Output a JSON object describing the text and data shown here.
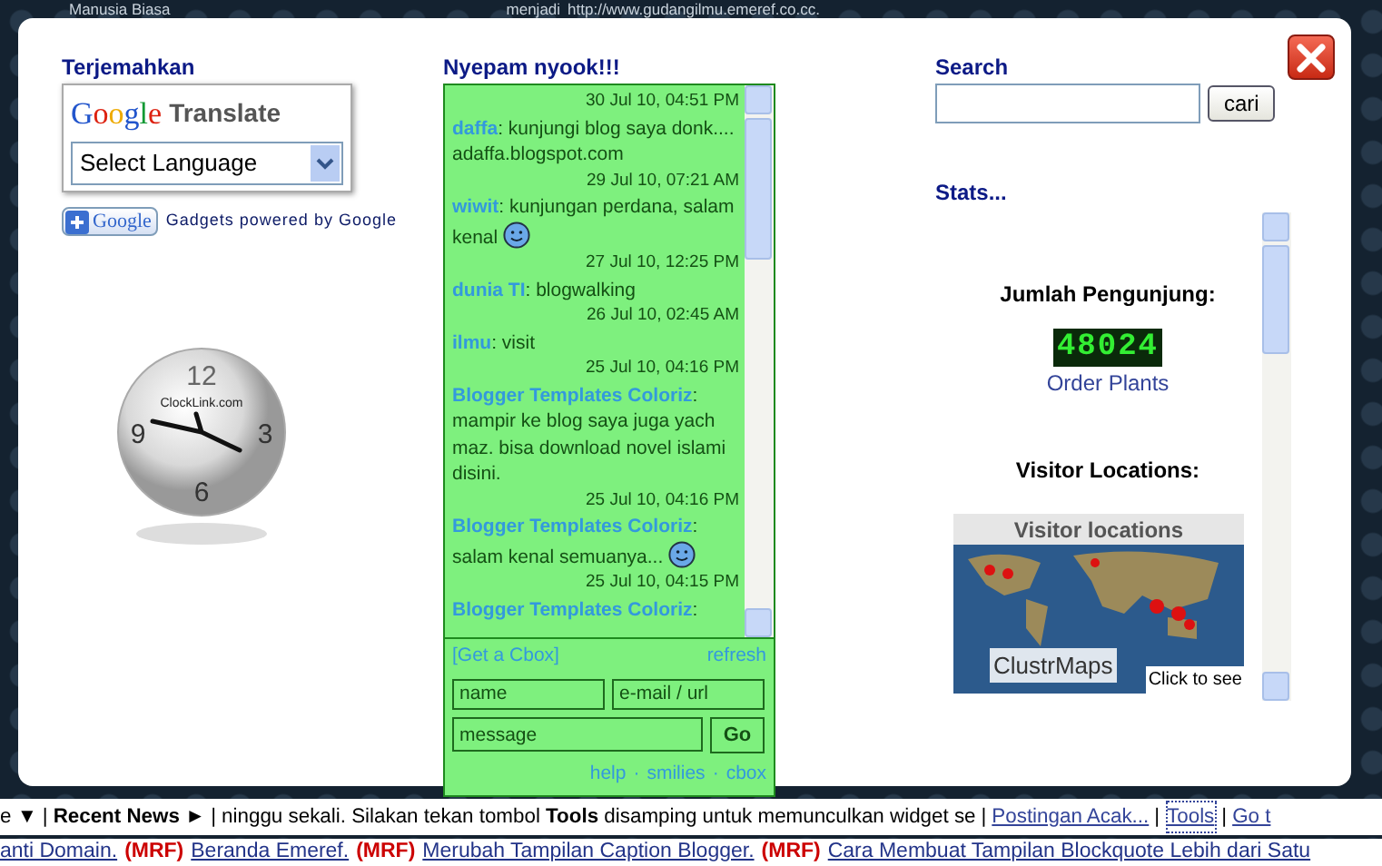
{
  "background": {
    "top_left_text": "Manusia Biasa",
    "top_text": "menjadi",
    "top_link": "http://www.gudangilmu.emeref.co.cc",
    "top_end": "."
  },
  "translate": {
    "heading": "Terjemahkan",
    "logo_word": "Google",
    "product": "Translate",
    "select": "Select Language",
    "gadget_button": "Google",
    "powered": "Gadgets powered by Google"
  },
  "clock": {
    "numbers": [
      "12",
      "3",
      "6",
      "9"
    ],
    "brand": "ClockLink.com"
  },
  "chat": {
    "heading": "Nyepam nyook!!!",
    "messages": [
      {
        "time": "30 Jul 10, 04:51 PM",
        "message": "**daffa**: kunjungi blog saya donk.... adaffa.blogspot.com",
        "smiley": false
      },
      {
        "time": "29 Jul 10, 07:21 AM",
        "message": "**wiwit**: kunjungan perdana, salam kenal",
        "smiley": true
      },
      {
        "time": "27 Jul 10, 12:25 PM",
        "message": "**dunia TI**: blogwalking",
        "smiley": false
      },
      {
        "time": "26 Jul 10, 02:45 AM",
        "message": "**ilmu**: visit",
        "smiley": false
      },
      {
        "time": "25 Jul 10, 04:16 PM",
        "message": "**Blogger Templates Coloriz**: mampir ke blog saya juga yach maz. bisa download novel islami disini.",
        "smiley": false
      },
      {
        "time": "25 Jul 10, 04:16 PM",
        "message": "**Blogger Templates Coloriz**: salam kenal semuanya...",
        "smiley": true
      },
      {
        "time": "25 Jul 10, 04:15 PM",
        "message": "**Blogger Templates Coloriz**:",
        "smiley": false
      }
    ],
    "get_link": "[Get a Cbox]",
    "refresh": "refresh",
    "name_placeholder": "name",
    "email_placeholder": "e-mail / url",
    "message_placeholder": "message",
    "go": "Go",
    "footer_links": [
      "help",
      "smilies",
      "cbox"
    ],
    "footer_separator": "·"
  },
  "search": {
    "heading": "Search",
    "button": "cari"
  },
  "stats": {
    "heading": "Stats...",
    "visitors_label": "Jumlah Pengunjung:",
    "counter": "48024",
    "counter_link": "Order Plants",
    "locations_label": "Visitor Locations:",
    "map_title": "Visitor locations",
    "map_brand": "ClustrMaps",
    "map_hint": "Click to see"
  },
  "ticker": [
    {
      "kind": "plain",
      "text": "e ▼"
    },
    {
      "kind": "sep",
      "text": "|"
    },
    {
      "kind": "bold",
      "text": "Recent News ►"
    },
    {
      "kind": "sep",
      "text": "|"
    },
    {
      "kind": "rich",
      "text": "ninggu sekali. Silakan tekan tombol **Tools** disamping untuk memunculkan widget se"
    },
    {
      "kind": "sep",
      "text": "|"
    },
    {
      "kind": "link",
      "text": "Postingan Acak..."
    },
    {
      "kind": "sep",
      "text": "|"
    },
    {
      "kind": "boxed",
      "text": "Tools"
    },
    {
      "kind": "sep",
      "text": "|"
    },
    {
      "kind": "link",
      "text": "Go t"
    }
  ],
  "news_line": [
    {
      "kind": "link",
      "text": "anti Domain."
    },
    {
      "kind": "tag",
      "text": "(MRF)"
    },
    {
      "kind": "link",
      "text": "Beranda Emeref."
    },
    {
      "kind": "tag",
      "text": "(MRF)"
    },
    {
      "kind": "link",
      "text": "Merubah Tampilan Caption Blogger."
    },
    {
      "kind": "tag",
      "text": "(MRF)"
    },
    {
      "kind": "link",
      "text": "Cara Membuat Tampilan Blockquote Lebih dari Satu"
    }
  ]
}
